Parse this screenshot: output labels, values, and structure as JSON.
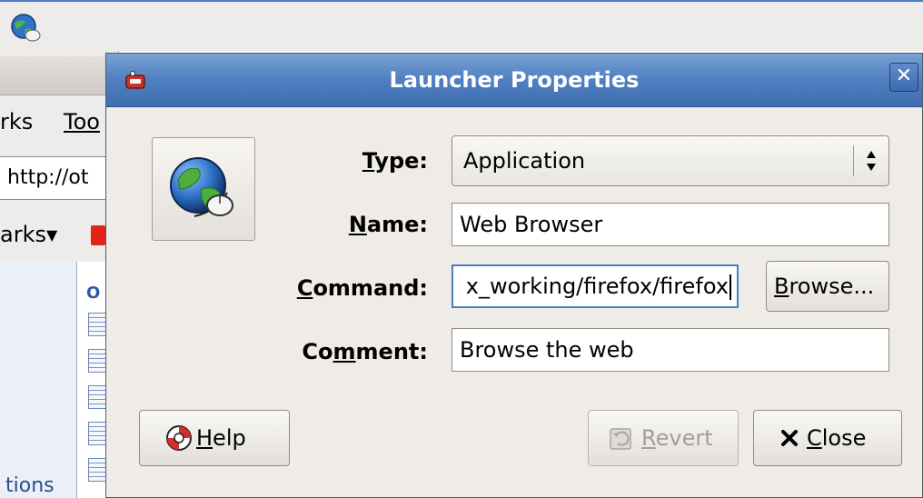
{
  "background": {
    "menu_items": [
      "rks",
      "Too"
    ],
    "url_fragment": "http://ot",
    "bookmarks_label": "arks",
    "sidebar_heading": "O",
    "sidebar_bottom_text": "tions"
  },
  "dialog": {
    "title": "Launcher Properties",
    "close_glyph": "✕",
    "icon_name": "web-browser-globe-icon",
    "fields": {
      "type": {
        "label_pre": "",
        "label_ul": "T",
        "label_post": "ype:",
        "value": "Application"
      },
      "name": {
        "label_pre": "",
        "label_ul": "N",
        "label_post": "ame:",
        "value": "Web Browser"
      },
      "command": {
        "label_pre": "",
        "label_ul": "C",
        "label_post": "ommand:",
        "value": "x_working/firefox/firefox"
      },
      "comment": {
        "label_pre": "Co",
        "label_ul": "m",
        "label_post": "ment:",
        "value": "Browse the web"
      }
    },
    "buttons": {
      "browse": {
        "ul": "B",
        "rest": "rowse..."
      },
      "help": {
        "ul": "H",
        "rest": "elp"
      },
      "revert": {
        "ul": "R",
        "rest": "evert"
      },
      "close": {
        "ul": "C",
        "rest": "lose"
      }
    }
  }
}
